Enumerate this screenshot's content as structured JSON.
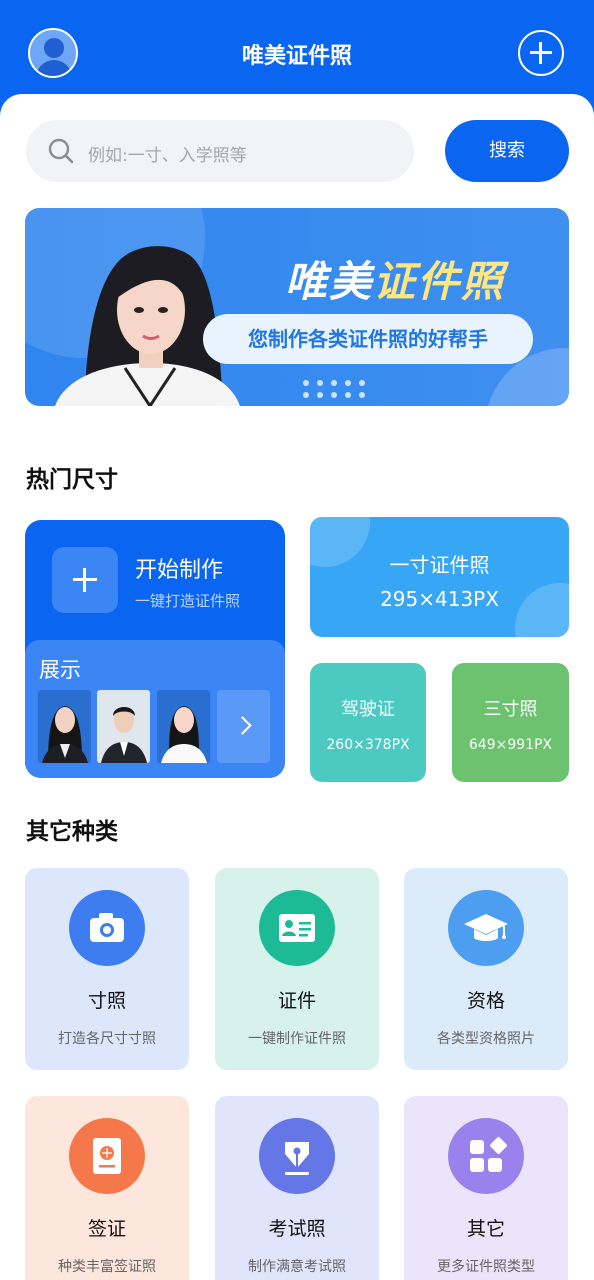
{
  "header": {
    "title": "唯美证件照",
    "avatar_icon": "user-avatar-icon",
    "add_icon": "plus-circle-icon"
  },
  "search": {
    "placeholder": "例如:一寸、入学照等",
    "button_label": "搜索"
  },
  "banner": {
    "title_part1": "唯美",
    "title_part2": "证件照",
    "subtitle": "您制作各类证件照的好帮手"
  },
  "hot_sizes": {
    "section_title": "热门尺寸",
    "make": {
      "title": "开始制作",
      "subtitle": "一键打造证件照",
      "showcase_title": "展示"
    },
    "one_inch": {
      "name": "一寸证件照",
      "size": "295×413PX",
      "color": "#37a6f4"
    },
    "driver": {
      "name": "驾驶证",
      "size": "260×378PX",
      "color": "#4cc9c0"
    },
    "three_inch": {
      "name": "三寸照",
      "size": "649×991PX",
      "color": "#6cc26f"
    }
  },
  "other": {
    "section_title": "其它种类",
    "items": [
      {
        "name": "寸照",
        "desc": "打造各尺寸寸照",
        "icon": "camera-icon"
      },
      {
        "name": "证件",
        "desc": "一键制作证件照",
        "icon": "id-card-icon"
      },
      {
        "name": "资格",
        "desc": "各类型资格照片",
        "icon": "graduation-cap-icon"
      },
      {
        "name": "签证",
        "desc": "种类丰富签证照",
        "icon": "passport-icon"
      },
      {
        "name": "考试照",
        "desc": "制作满意考试照",
        "icon": "pen-nib-icon"
      },
      {
        "name": "其它",
        "desc": "更多证件照类型",
        "icon": "apps-icon"
      }
    ]
  }
}
